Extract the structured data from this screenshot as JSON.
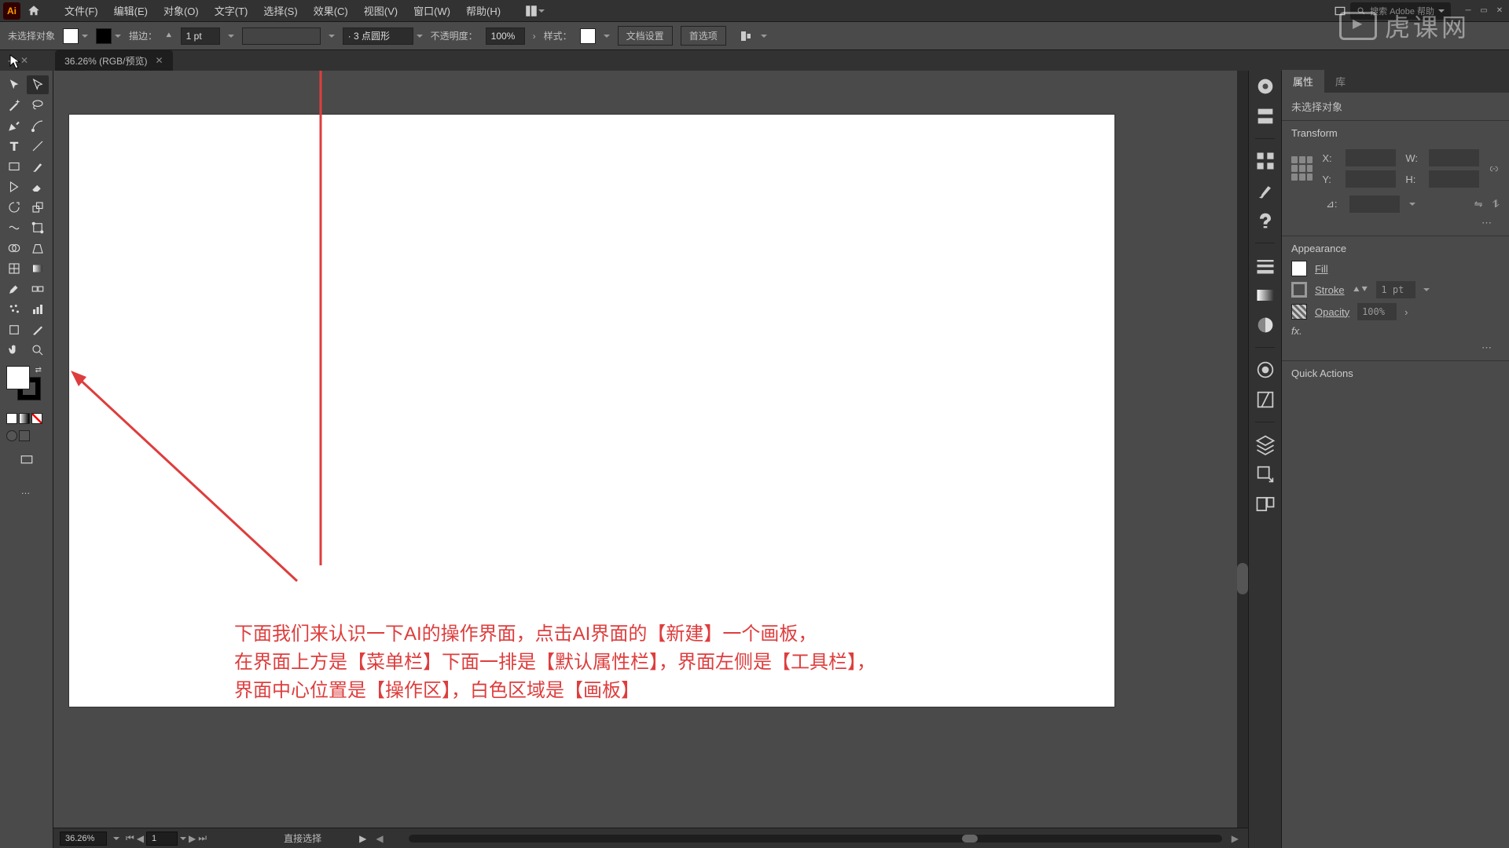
{
  "menu": {
    "items": [
      "文件(F)",
      "编辑(E)",
      "对象(O)",
      "文字(T)",
      "选择(S)",
      "效果(C)",
      "视图(V)",
      "窗口(W)",
      "帮助(H)"
    ],
    "search_placeholder": "搜索 Adobe 帮助"
  },
  "control": {
    "no_selection": "未选择对象",
    "stroke_label": "描边：",
    "stroke_pt": "1 pt",
    "dash_option": "· 3 点圆形",
    "opacity_label": "不透明度：",
    "opacity_value": "100%",
    "style_label": "样式：",
    "doc_setup": "文档设置",
    "prefs": "首选项"
  },
  "doc": {
    "tab_title": "36.26% (RGB/预览)"
  },
  "tools": {
    "names": [
      [
        "selection",
        "direct-selection"
      ],
      [
        "wand",
        "lasso"
      ],
      [
        "pen",
        "curvature"
      ],
      [
        "type",
        "line"
      ],
      [
        "rectangle",
        "brush"
      ],
      [
        "shaper",
        "eraser"
      ],
      [
        "rotate",
        "scale"
      ],
      [
        "width",
        "free-transform"
      ],
      [
        "shape-builder",
        "perspective"
      ],
      [
        "mesh",
        "gradient"
      ],
      [
        "eyedropper",
        "blend"
      ],
      [
        "symbol-sprayer",
        "graph"
      ],
      [
        "artboard",
        "slice"
      ],
      [
        "hand",
        "zoom"
      ]
    ],
    "edit_toolbar": "…"
  },
  "panel": {
    "tabs": [
      "属性",
      "库"
    ],
    "no_selection": "未选择对象",
    "transform": {
      "title": "Transform",
      "x": "X:",
      "x_val": "",
      "y": "Y:",
      "y_val": "",
      "w": "W:",
      "w_val": "",
      "h": "H:",
      "h_val": "",
      "angle": "⊿:"
    },
    "appearance": {
      "title": "Appearance",
      "fill": "Fill",
      "stroke": "Stroke",
      "stroke_val": "1 pt",
      "opacity": "Opacity",
      "opacity_val": "100%",
      "fx": "fx."
    },
    "quick_actions": "Quick Actions"
  },
  "status": {
    "zoom": "36.26%",
    "artboard": "1",
    "tool": "直接选择"
  },
  "annot": {
    "line1": "下面我们来认识一下AI的操作界面，点击AI界面的【新建】一个画板，",
    "line2": "在界面上方是【菜单栏】下面一排是【默认属性栏】，界面左侧是【工具栏】，",
    "line3": "界面中心位置是【操作区】，白色区域是【画板】"
  },
  "watermark": "虎课网"
}
